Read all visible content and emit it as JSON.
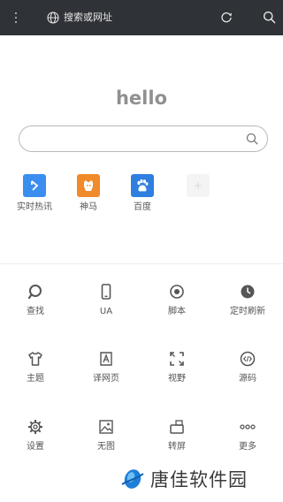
{
  "topbar": {
    "url_text": "搜索或网址",
    "icons": [
      "more-vertical-icon",
      "globe-icon",
      "refresh-icon",
      "search-icon"
    ]
  },
  "home": {
    "title": "hello",
    "search_value": ""
  },
  "shortcuts": [
    {
      "label": "实时热讯",
      "icon": "trend-arrow-icon",
      "color": "#3b8ef0"
    },
    {
      "label": "神马",
      "icon": "shenma-logo-icon",
      "color": "#f08a2a"
    },
    {
      "label": "百度",
      "icon": "baidu-paw-icon",
      "color": "#2f7fe0"
    },
    {
      "label": "",
      "icon": "add-icon",
      "color": "#f4f4f4"
    }
  ],
  "tools": [
    {
      "label": "查找",
      "icon": "find-icon"
    },
    {
      "label": "UA",
      "icon": "phone-icon"
    },
    {
      "label": "脚本",
      "icon": "script-icon"
    },
    {
      "label": "定时刷新",
      "icon": "clock-icon"
    },
    {
      "label": "主题",
      "icon": "tshirt-icon"
    },
    {
      "label": "译网页",
      "icon": "translate-icon"
    },
    {
      "label": "视野",
      "icon": "fullscreen-icon"
    },
    {
      "label": "源码",
      "icon": "source-code-icon"
    },
    {
      "label": "设置",
      "icon": "gear-icon"
    },
    {
      "label": "无图",
      "icon": "no-image-icon"
    },
    {
      "label": "转屏",
      "icon": "rotate-screen-icon"
    },
    {
      "label": "更多",
      "icon": "more-dots-icon"
    }
  ],
  "watermark": {
    "text": "唐佳软件园"
  }
}
